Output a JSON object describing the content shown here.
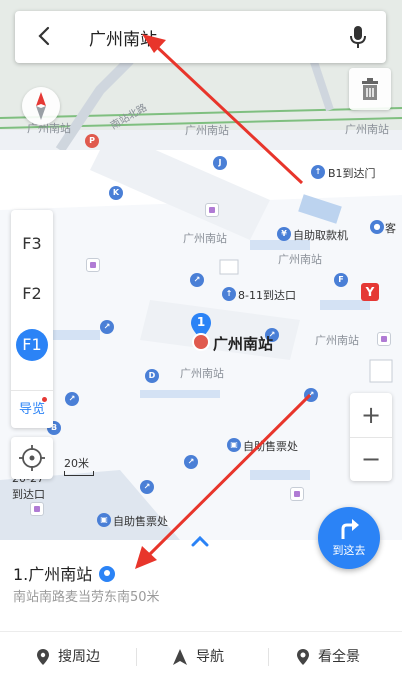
{
  "search": {
    "query": "广州南站"
  },
  "map": {
    "labels": {
      "gzns_a": "广州南站",
      "gzns_b": "广州南站",
      "gzns_c": "广州南站",
      "gzns_d": "广州南站",
      "gzns_e": "广州南站",
      "gzns_f": "广州南站",
      "gzns_g": "广州南站",
      "nanzhan_rd": "南站北路",
      "b1_exit": "B1到达门",
      "atm": "自助取款机",
      "exit_811": "8-11到达口",
      "ticket_a": "自助售票处",
      "ticket_b": "自助售票处",
      "exit_2027": "20-27",
      "exit_2027_b": "到达口",
      "ke": "客"
    },
    "main_poi": {
      "label": "广州南站",
      "badge": "1"
    }
  },
  "floors": [
    "F3",
    "F2",
    "F1"
  ],
  "active_floor": "F1",
  "guide_label": "导览",
  "scale_label": "20米",
  "zoom": {
    "in": "+",
    "out": "−"
  },
  "goto_label": "到这去",
  "result": {
    "title": "1.广州南站",
    "subtitle": "南站南路麦当劳东南50米"
  },
  "actions": {
    "nearby": "搜周边",
    "navigate": "导航",
    "panorama": "看全景"
  },
  "colors": {
    "accent": "#2b83f6",
    "arrow": "#e8352b"
  }
}
